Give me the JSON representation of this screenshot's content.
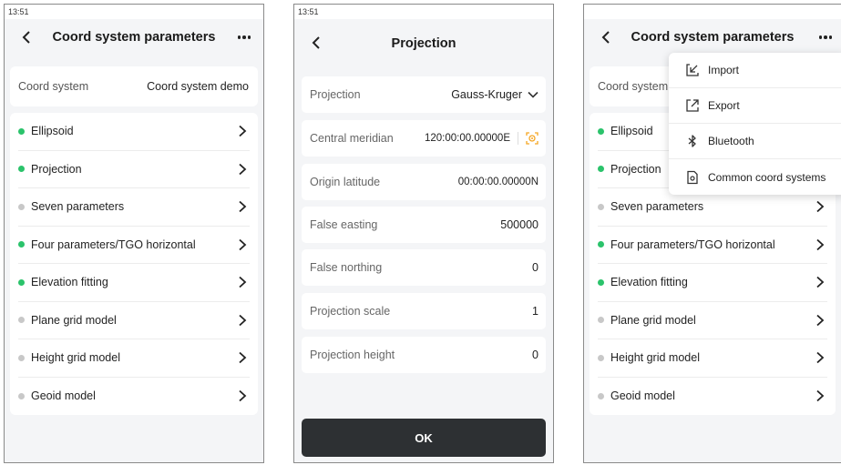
{
  "phone1": {
    "status_time": "13:51",
    "title": "Coord system parameters",
    "coord_system": {
      "label": "Coord system",
      "value": "Coord system demo"
    },
    "items": [
      {
        "label": "Ellipsoid",
        "status": "active"
      },
      {
        "label": "Projection",
        "status": "active"
      },
      {
        "label": "Seven parameters",
        "status": "inactive"
      },
      {
        "label": "Four parameters/TGO horizontal",
        "status": "active"
      },
      {
        "label": "Elevation fitting",
        "status": "active"
      },
      {
        "label": "Plane grid model",
        "status": "inactive"
      },
      {
        "label": "Height grid model",
        "status": "inactive"
      },
      {
        "label": "Geoid model",
        "status": "inactive"
      }
    ]
  },
  "phone2": {
    "status_time": "13:51",
    "title": "Projection",
    "rows": [
      {
        "label": "Projection",
        "value": "Gauss-Kruger"
      },
      {
        "label": "Central meridian",
        "value": "120:00:00.00000E"
      },
      {
        "label": "Origin latitude",
        "value": "00:00:00.00000N"
      },
      {
        "label": "False easting",
        "value": "500000"
      },
      {
        "label": "False northing",
        "value": "0"
      },
      {
        "label": "Projection scale",
        "value": "1"
      },
      {
        "label": "Projection height",
        "value": "0"
      }
    ],
    "ok_label": "OK"
  },
  "phone3": {
    "title": "Coord system parameters",
    "coord_system_label": "Coord system",
    "items": [
      {
        "label": "Ellipsoid",
        "status": "active"
      },
      {
        "label": "Projection",
        "status": "active"
      },
      {
        "label": "Seven parameters",
        "status": "inactive"
      },
      {
        "label": "Four parameters/TGO horizontal",
        "status": "active"
      },
      {
        "label": "Elevation fitting",
        "status": "active"
      },
      {
        "label": "Plane grid model",
        "status": "inactive"
      },
      {
        "label": "Height grid model",
        "status": "inactive"
      },
      {
        "label": "Geoid model",
        "status": "inactive"
      }
    ],
    "menu": [
      {
        "label": "Import",
        "icon": "import-icon"
      },
      {
        "label": "Export",
        "icon": "export-icon"
      },
      {
        "label": "Bluetooth",
        "icon": "bluetooth-icon"
      },
      {
        "label": "Common coord systems",
        "icon": "document-icon"
      }
    ]
  },
  "colors": {
    "active_dot": "#2bc36b",
    "inactive_dot": "#c8c8c8",
    "accent": "#f5a623",
    "button_dark": "#2d3033"
  }
}
